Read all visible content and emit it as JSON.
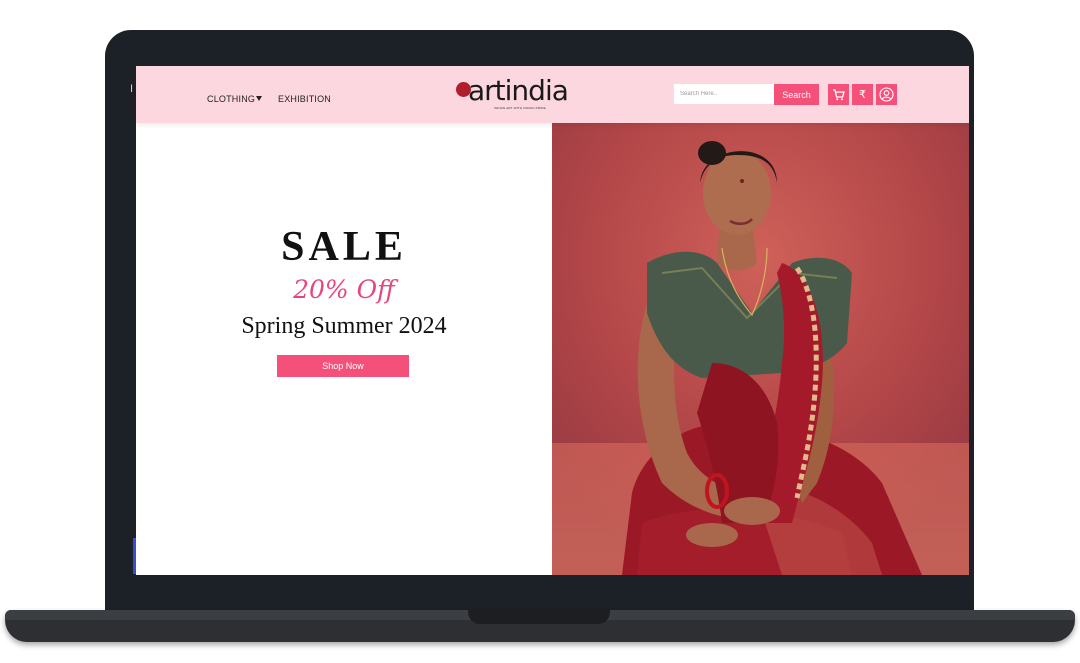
{
  "nav": {
    "clothing_label": "CLOTHING",
    "exhibition_label": "EXHIBITION"
  },
  "logo": {
    "text": "artindia",
    "tagline": "INDIAN ART WITH INDIAN PRIDE"
  },
  "search": {
    "placeholder": "Search Here..",
    "button_label": "Search"
  },
  "header_icons": {
    "cart": "cart-icon",
    "currency": "₹",
    "account": "user-icon"
  },
  "hero": {
    "title": "SALE",
    "discount": "20% Off",
    "season": "Spring Summer 2024",
    "cta_label": "Shop Now"
  },
  "colors": {
    "accent": "#f4507a",
    "navbar_bg": "#fdd7df",
    "frame": "#1b2126"
  }
}
